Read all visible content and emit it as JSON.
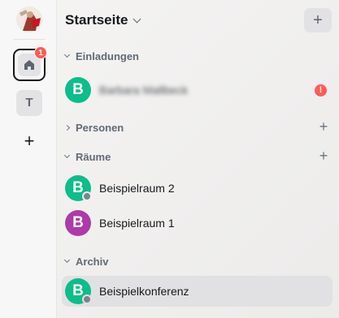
{
  "colors": {
    "avatar_green": "#0dbd8b",
    "avatar_purple": "#ac3ba8",
    "badge_red": "#ff5b55",
    "selected_bg": "#e1e1e3"
  },
  "spaces_bar": {
    "user_avatar_icon": "user-avatar-image",
    "home": {
      "icon": "home-icon",
      "badge": "1"
    },
    "space_t": {
      "letter": "T"
    },
    "add_space": {
      "icon": "plus-icon",
      "label": "+"
    }
  },
  "header": {
    "title": "Startseite",
    "add_label": "+"
  },
  "sections": {
    "invites": {
      "label": "Einladungen",
      "rooms": [
        {
          "letter": "B",
          "name": "Barbara Mallbeck",
          "badge": "!"
        }
      ]
    },
    "people": {
      "label": "Personen",
      "add_label": "+"
    },
    "rooms": {
      "label": "Räume",
      "add_label": "+",
      "rooms": [
        {
          "letter": "B",
          "name": "Beispielraum 2"
        },
        {
          "letter": "B",
          "name": "Beispielraum 1"
        }
      ]
    },
    "archive": {
      "label": "Archiv",
      "rooms": [
        {
          "letter": "B",
          "name": "Beispielkonferenz"
        }
      ]
    }
  }
}
